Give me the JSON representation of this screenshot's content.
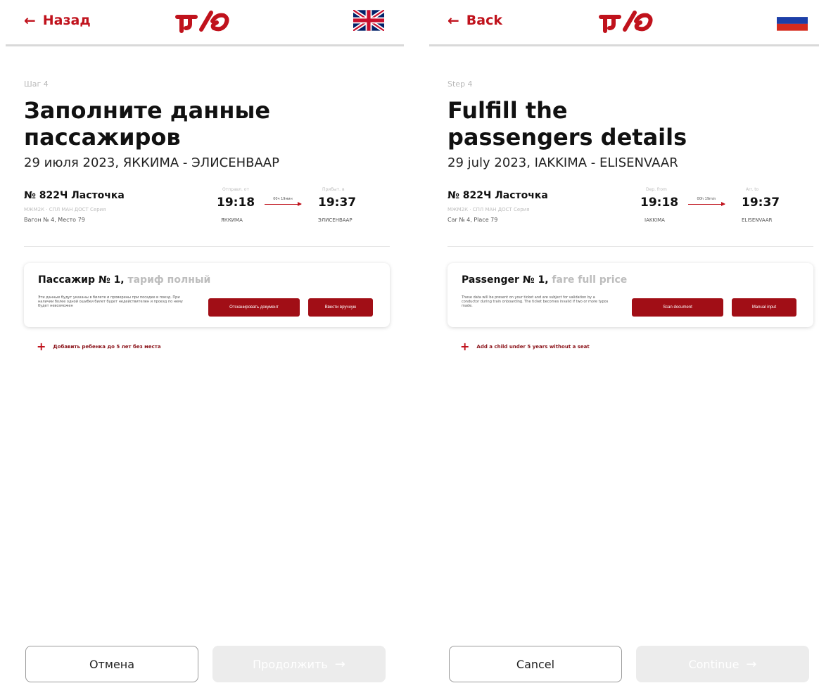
{
  "brand": {
    "accent": "#c0121c",
    "button": "#a10e16",
    "disabled": "#ececec"
  },
  "screens": [
    {
      "lang": "ru",
      "back_label": "Назад",
      "flag": "uk-flag-icon",
      "step": "Шаг 4",
      "title_line1": "Заполните данные",
      "title_line2": "пассажиров",
      "subtitle": "29 июля 2023, ЯККИМА - ЭЛИСЕНВААР",
      "train": {
        "name": "№ 822Ч Ласточка",
        "meta": "МЖМ2К · СПЛ МАН ДОСТ Серия",
        "seat": "Вагон № 4, Место 79",
        "dep_label": "Отправл. от",
        "dep_time": "19:18",
        "dep_station": "ЯККИМА",
        "duration": "00ч 19мин",
        "arr_label": "Прибыт. в",
        "arr_time": "19:37",
        "arr_station": "ЭЛИСЕНВААР"
      },
      "passenger": {
        "title": "Пассажир № 1,",
        "fare": "тариф полный",
        "note": "Эти данные будут указаны в билете и проверены при посадке в поезд. При наличии более одной ошибки билет будет недействителен и проезд по нему будет невозможен",
        "scan_label": "Отсканировать документ",
        "manual_label": "Ввести вручную"
      },
      "add_child": "Добавить ребенка до 5 лет без места",
      "cancel_label": "Отмена",
      "continue_label": "Продолжить"
    },
    {
      "lang": "en",
      "back_label": "Back",
      "flag": "russia-flag-icon",
      "step": "Step 4",
      "title_line1": "Fulfill the",
      "title_line2": "passengers details",
      "subtitle": "29 july 2023, IAKKIMA - ELISENVAAR",
      "train": {
        "name": "№ 822Ч Ласточка",
        "meta": "МЖМ2К · СПЛ МАН ДОСТ Серия",
        "seat": "Car № 4, Place 79",
        "dep_label": "Dep. from",
        "dep_time": "19:18",
        "dep_station": "IAKKIMA",
        "duration": "00h 19min",
        "arr_label": "Arr. to",
        "arr_time": "19:37",
        "arr_station": "ELISENVAAR"
      },
      "passenger": {
        "title": "Passenger № 1,",
        "fare": "fare full price",
        "note": "These data will be present on your ticket and are subject for validation by a conductor during train onboarding. The ticket becomes invalid if two or more typos made.",
        "scan_label": "Scan document",
        "manual_label": "Manual input"
      },
      "add_child": "Add a child under 5 years without a seat",
      "cancel_label": "Cancel",
      "continue_label": "Continue"
    }
  ]
}
